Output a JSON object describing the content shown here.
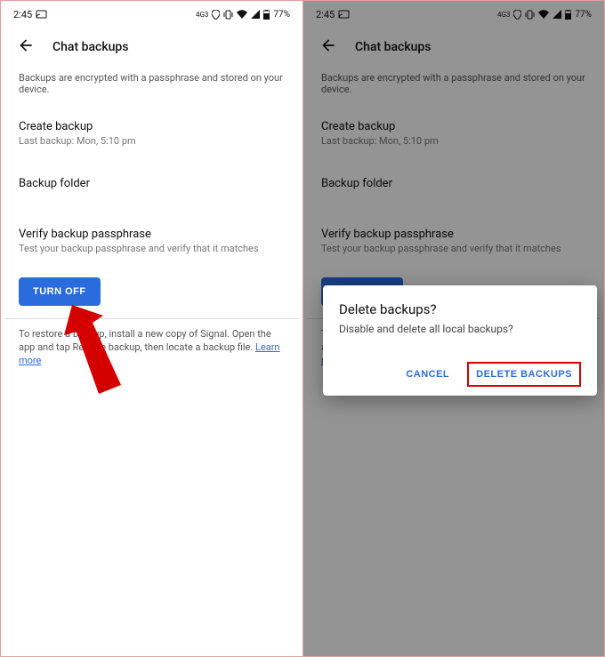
{
  "status": {
    "time": "2:45",
    "network_label": "4G3",
    "battery_pct": "77%"
  },
  "header": {
    "title": "Chat backups"
  },
  "description": "Backups are encrypted with a passphrase and stored on your device.",
  "items": {
    "create": {
      "title": "Create backup",
      "sub": "Last backup: Mon, 5:10 pm"
    },
    "folder": {
      "title": "Backup folder"
    },
    "verify": {
      "title": "Verify backup passphrase",
      "sub": "Test your backup passphrase and verify that it matches"
    }
  },
  "turn_off_label": "TURN OFF",
  "footer": {
    "text_before": "To restore a backup, install a new copy of Signal. Open the app and tap Restore backup, then locate a backup file. ",
    "text_obscured": "To restore a backup, install a new copy of Signal. Open the app and tap Restore backup, then locate a backup file. ",
    "learn_more": "Learn more"
  },
  "dialog": {
    "title": "Delete backups?",
    "message": "Disable and delete all local backups?",
    "cancel": "CANCEL",
    "confirm": "DELETE BACKUPS"
  }
}
